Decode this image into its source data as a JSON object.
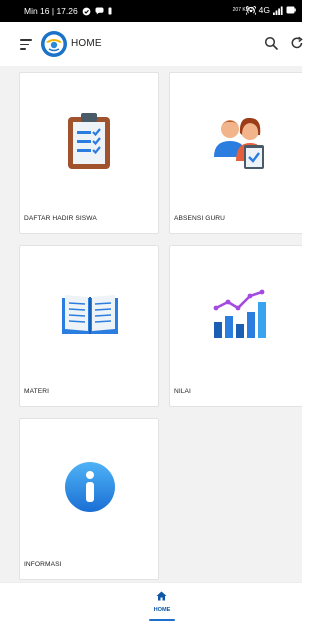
{
  "status_bar": {
    "time": "Min 16 | 17.26",
    "network": "4G",
    "network_small": "207 KB/S"
  },
  "app_bar": {
    "title": "HOME",
    "menu_icon": "hamburger-menu-icon",
    "search_icon": "search-icon",
    "refresh_icon": "refresh-icon"
  },
  "menu": {
    "items": [
      {
        "label": "DAFTAR HADIR SISWA",
        "icon": "clipboard-checklist-icon"
      },
      {
        "label": "ABSENSI GURU",
        "icon": "teachers-attendance-icon"
      },
      {
        "label": "MATERI",
        "icon": "open-book-icon"
      },
      {
        "label": "NILAI",
        "icon": "bar-chart-icon"
      },
      {
        "label": "INFORMASI",
        "icon": "info-icon"
      }
    ]
  },
  "bottom_nav": {
    "home_label": "HOME",
    "active": "HOME",
    "accent_color": "#1f6fcb"
  }
}
